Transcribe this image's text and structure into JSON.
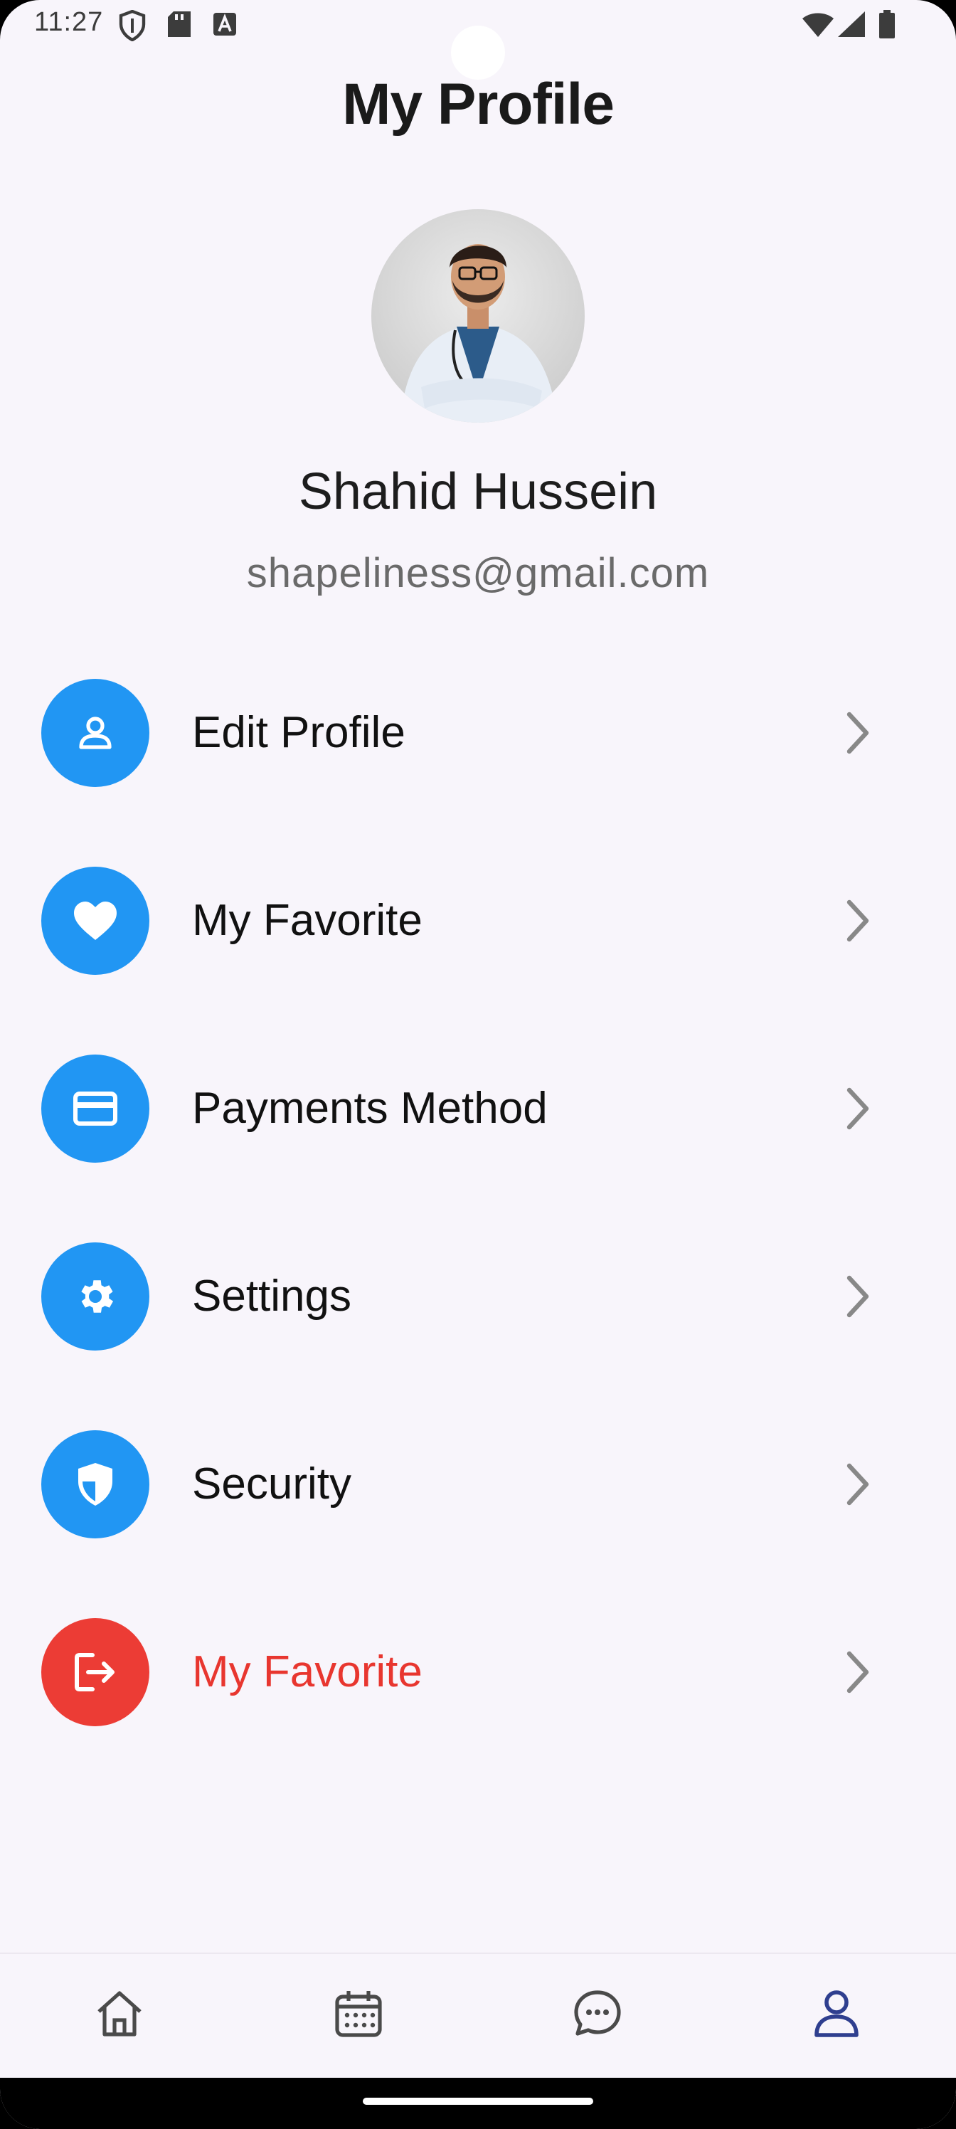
{
  "status_bar": {
    "time": "11:27",
    "icons": [
      "shield-icon",
      "sd-card-icon",
      "font-icon",
      "wifi-icon",
      "signal-icon",
      "battery-icon"
    ]
  },
  "header": {
    "title": "My Profile"
  },
  "profile": {
    "name": "Shahid Hussein",
    "email": "shapeliness@gmail.com",
    "avatar_icon": "profile-photo"
  },
  "menu": {
    "items": [
      {
        "label": "Edit Profile",
        "icon": "person-icon"
      },
      {
        "label": "My Favorite",
        "icon": "heart-icon"
      },
      {
        "label": "Payments Method",
        "icon": "credit-card-icon"
      },
      {
        "label": "Settings",
        "icon": "gear-icon"
      },
      {
        "label": "Security",
        "icon": "shield-icon"
      },
      {
        "label": "My Favorite",
        "icon": "logout-icon"
      }
    ]
  },
  "bottom_nav": {
    "items": [
      "home-icon",
      "calendar-icon",
      "chat-icon",
      "profile-icon"
    ],
    "active": "profile-icon"
  },
  "colors": {
    "accent": "#2196F3",
    "danger": "#EC3C35",
    "background": "#F8F5FB",
    "active_nav": "#2F3F8F",
    "inactive_nav": "#4a4a4a"
  }
}
